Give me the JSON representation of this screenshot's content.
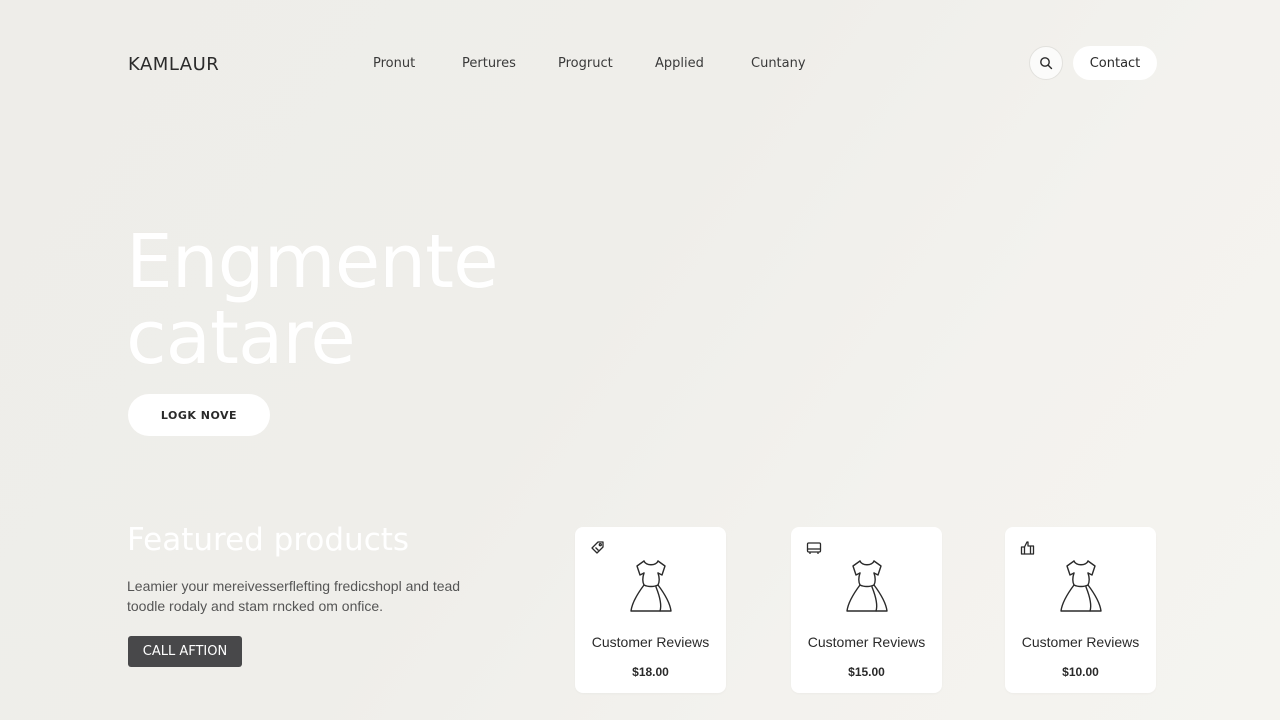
{
  "brand": {
    "logo_text": "KAMLAUR"
  },
  "nav": {
    "items": [
      {
        "label": "Pronut"
      },
      {
        "label": "Pertures"
      },
      {
        "label": "Progruct"
      },
      {
        "label": "Applied"
      },
      {
        "label": "Cuntany"
      }
    ],
    "search_icon": "search-icon",
    "contact_label": "Contact"
  },
  "hero": {
    "title_line1": "Engmente",
    "title_line2": "catare",
    "button_label": "LOGK NOVE"
  },
  "featured": {
    "title": "Featured products",
    "desc_line1": "Leamier your mereivesserflefting fredicshopl and tead",
    "desc_line2": "toodle rodaly and stam rncked om onfice.",
    "cta_label": "CALL AFTION"
  },
  "products": [
    {
      "title": "Customer Reviews",
      "price": "$18.00",
      "corner_icon": "tag-icon",
      "image_icon": "dress-icon"
    },
    {
      "title": "Customer Reviews",
      "price": "$15.00",
      "corner_icon": "tray-icon",
      "image_icon": "dress-icon"
    },
    {
      "title": "Customer Reviews",
      "price": "$10.00",
      "corner_icon": "thumbs-up-icon",
      "image_icon": "dress-icon"
    }
  ],
  "colors": {
    "background": "#efeeea",
    "card": "#ffffff",
    "cta": "#48484a",
    "hero_text": "#ffffff"
  }
}
